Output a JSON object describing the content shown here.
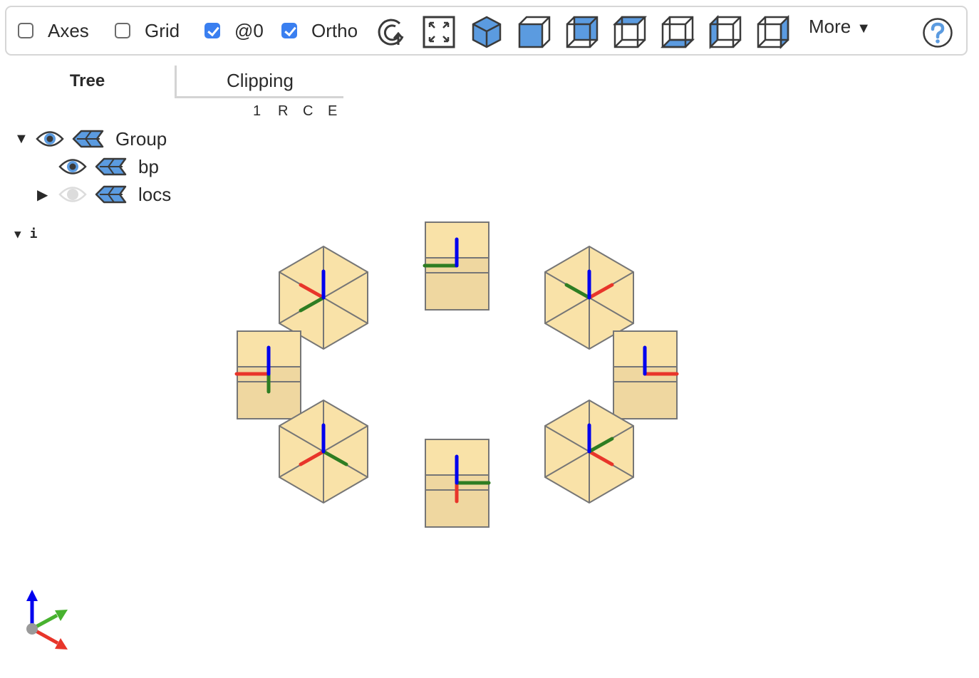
{
  "toolbar": {
    "checkboxes": [
      {
        "label": "Axes",
        "checked": false
      },
      {
        "label": "Grid",
        "checked": false
      },
      {
        "label": "@0",
        "checked": true
      },
      {
        "label": "Ortho",
        "checked": true
      }
    ],
    "buttons": [
      {
        "name": "reset-view",
        "icon": "rotate-reset-icon"
      },
      {
        "name": "resize",
        "icon": "expand-icon"
      },
      {
        "name": "iso-view",
        "icon": "iso-cube-icon"
      },
      {
        "name": "front-view",
        "icon": "front-cube-icon"
      },
      {
        "name": "rear-view",
        "icon": "rear-cube-icon"
      },
      {
        "name": "top-view",
        "icon": "top-cube-icon"
      },
      {
        "name": "bottom-view",
        "icon": "bottom-cube-icon"
      },
      {
        "name": "left-view",
        "icon": "left-cube-icon"
      },
      {
        "name": "right-view",
        "icon": "right-cube-icon"
      }
    ],
    "more_label": "More",
    "more_arrow": "▼",
    "help_icon": "help-icon"
  },
  "tabs": {
    "tree_label": "Tree",
    "clipping_label": "Clipping",
    "clip_options": [
      "1",
      "R",
      "C",
      "E"
    ]
  },
  "tree": {
    "nodes": [
      {
        "label": "Group",
        "toggle": "▼",
        "visible": true,
        "level": 0
      },
      {
        "label": "bp",
        "toggle": "",
        "visible": true,
        "level": 1
      },
      {
        "label": "locs",
        "toggle": "▶",
        "visible": false,
        "level": 1
      }
    ]
  },
  "info": {
    "caret": "▼",
    "label": "i"
  },
  "colors": {
    "accent": "#3a7ff0",
    "icon_blue": "#5b9be0",
    "face_light": "#f9e2a8",
    "face_dark": "#efd7a0",
    "edge": "#767676",
    "axis_x": "#e8352a",
    "axis_y": "#2e7d22",
    "axis_z": "#0000ee"
  }
}
